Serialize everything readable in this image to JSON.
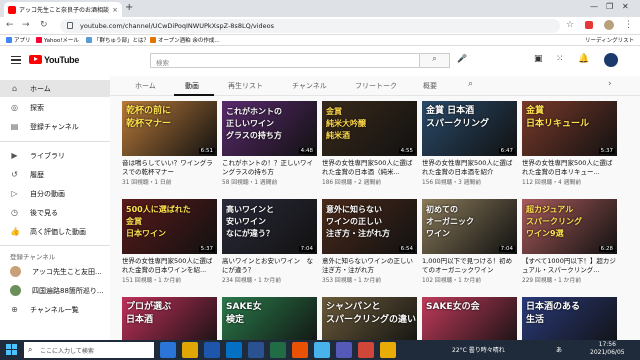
{
  "browser": {
    "tab_title": "アッコ先生こと奈良子のお酒相談...",
    "tab_close": "×",
    "new_tab": "+",
    "url": "youtube.com/channel/UCwDiPoqINWUPkXspZ-8s8LQ/videos",
    "bookmarks": [
      {
        "label": "アプリ",
        "color": "#4285f4"
      },
      {
        "label": "Yahoo!メール",
        "color": "#ff0033"
      },
      {
        "label": "「群ちゅう部」とは？",
        "color": "#5b9bd5"
      },
      {
        "label": "オープン酒粕 余の作成...",
        "color": "#e37400"
      }
    ],
    "reading_list": "リーディングリスト"
  },
  "youtube": {
    "logo_text": "YouTube",
    "search_placeholder": "検索",
    "search_icon": "search-icon",
    "sidebar": {
      "items": [
        {
          "label": "ホーム",
          "icon": "home-icon",
          "glyph": "⌂"
        },
        {
          "label": "探索",
          "icon": "explore-icon",
          "glyph": "◎"
        },
        {
          "label": "登録チャンネル",
          "icon": "subscriptions-icon",
          "glyph": "▤"
        }
      ],
      "items2": [
        {
          "label": "ライブラリ",
          "icon": "library-icon",
          "glyph": "▶"
        },
        {
          "label": "履歴",
          "icon": "history-icon",
          "glyph": "↺"
        },
        {
          "label": "自分の動画",
          "icon": "your-videos-icon",
          "glyph": "▷"
        },
        {
          "label": "後で見る",
          "icon": "watch-later-icon",
          "glyph": "◷"
        },
        {
          "label": "高く評価した動画",
          "icon": "liked-icon",
          "glyph": "👍"
        }
      ],
      "subs_heading": "登録チャンネル",
      "subs": [
        {
          "label": "アッコ先生こと友田...",
          "color": "#c9a07a"
        },
        {
          "label": "四国遍路88箇所巡り...",
          "color": "#6b8e5a"
        },
        {
          "label": "チャンネル一覧",
          "color": "#ffffff"
        }
      ]
    },
    "channel_tabs": [
      "ホーム",
      "動画",
      "再生リスト",
      "チャンネル",
      "フリートーク",
      "概要"
    ],
    "active_tab": "動画",
    "videos": [
      {
        "thumb_lines": [
          "乾杯の前に",
          "乾杯マナー"
        ],
        "bg": "#b87a3a",
        "fg": "#ffe14d",
        "duration": "6:51",
        "title": "音は鳴らしていい？ワイングラスでの乾杯マナー",
        "meta": "31 回視聴・1 日前"
      },
      {
        "thumb_lines": [
          "これがホントの",
          "正しいワイン",
          "グラスの持ち方"
        ],
        "bg": "#5a2a6e",
        "fg": "#ffffff",
        "duration": "4:48",
        "title": "これがホントの！？正しいワイングラスの持ち方",
        "meta": "58 回視聴・1 週間前"
      },
      {
        "thumb_lines": [
          "金賞",
          "純米大吟醸",
          "純米酒"
        ],
        "bg": "#3a2a1a",
        "fg": "#ffd84a",
        "duration": "4:55",
        "title": "世界の女性専門家500人に選ばれた金賞の日本酒（純米...",
        "meta": "186 回視聴・2 週間前"
      },
      {
        "thumb_lines": [
          "金賞 日本酒",
          "スパークリング"
        ],
        "bg": "#2a4a6a",
        "fg": "#ffffff",
        "duration": "6:47",
        "title": "世界の女性専門家500人に選ばれた金賞の日本酒を紹介",
        "meta": "156 回視聴・3 週間前"
      },
      {
        "thumb_lines": [
          "金賞",
          "日本リキュール"
        ],
        "bg": "#7a3a2a",
        "fg": "#ffe14d",
        "duration": "5:37",
        "title": "世界の女性専門家500人に選ばれた金賞の日本リキュー...",
        "meta": "112 回視聴・4 週間前"
      },
      {
        "thumb_lines": [
          "500人に選ばれた",
          "金賞",
          "日本ワイン"
        ],
        "bg": "#5a1a1a",
        "fg": "#ffe14d",
        "duration": "5:37",
        "title": "世界の女性専門家500人に選ばれた金賞の日本ワインを紹...",
        "meta": "151 回視聴・1 か月前"
      },
      {
        "thumb_lines": [
          "高いワインと",
          "安いワイン",
          "なにが違う？"
        ],
        "bg": "#2a2a3a",
        "fg": "#ffffff",
        "duration": "7:04",
        "title": "高いワインとお安いワイン　なにが違う？",
        "meta": "234 回視聴・1 か月前"
      },
      {
        "thumb_lines": [
          "意外に知らない",
          "ワインの正しい",
          "注ぎ方・注がれ方"
        ],
        "bg": "#4a2a1a",
        "fg": "#ffffff",
        "duration": "6:54",
        "title": "意外に知らないワインの正しい注ぎ方・注がれ方",
        "meta": "353 回視聴・1 か月前"
      },
      {
        "thumb_lines": [
          "初めての",
          "オーガニック",
          "ワイン"
        ],
        "bg": "#8a7a5a",
        "fg": "#ffffff",
        "duration": "7:04",
        "title": "1,000円以下で見つける！初めてのオーガニックワイン",
        "meta": "102 回視聴・1 か月前"
      },
      {
        "thumb_lines": [
          "超カジュアル",
          "スパークリング",
          "ワイン9選"
        ],
        "bg": "#a85a5a",
        "fg": "#ffe14d",
        "duration": "6:28",
        "title": "【すべて1000円以下！】超カジュアル・スパークリング...",
        "meta": "229 回視聴・1 か月前"
      },
      {
        "thumb_lines": [
          "プロが選ぶ",
          "日本酒"
        ],
        "bg": "#c0305a",
        "fg": "#ffffff",
        "duration": "",
        "title": "",
        "meta": ""
      },
      {
        "thumb_lines": [
          "SAKE女",
          "検定"
        ],
        "bg": "#2a7a4a",
        "fg": "#ffffff",
        "duration": "",
        "title": "",
        "meta": ""
      },
      {
        "thumb_lines": [
          "シャンパンと",
          "スパークリングの違い"
        ],
        "bg": "#6a5a3a",
        "fg": "#ffffff",
        "duration": "",
        "title": "",
        "meta": ""
      },
      {
        "thumb_lines": [
          "SAKE女の会"
        ],
        "bg": "#c03a5a",
        "fg": "#ffffff",
        "duration": "",
        "title": "",
        "meta": ""
      },
      {
        "thumb_lines": [
          "日本酒のある",
          "生活"
        ],
        "bg": "#2a3a7a",
        "fg": "#ffffff",
        "duration": "",
        "title": "",
        "meta": ""
      }
    ]
  },
  "taskbar": {
    "search_placeholder": "ここに入力して検索",
    "weather": "22°C  曇り時々晴れ",
    "ime": "あ",
    "time": "17:56",
    "date": "2021/06/05",
    "apps": [
      "#2b7de9",
      "#f4b400",
      "#1e5bb8",
      "#0078d4",
      "#2b579a",
      "#217346",
      "#ff5500",
      "#4cc2ff",
      "#5b5fc7",
      "#e34a3a",
      "#ffb900"
    ]
  }
}
